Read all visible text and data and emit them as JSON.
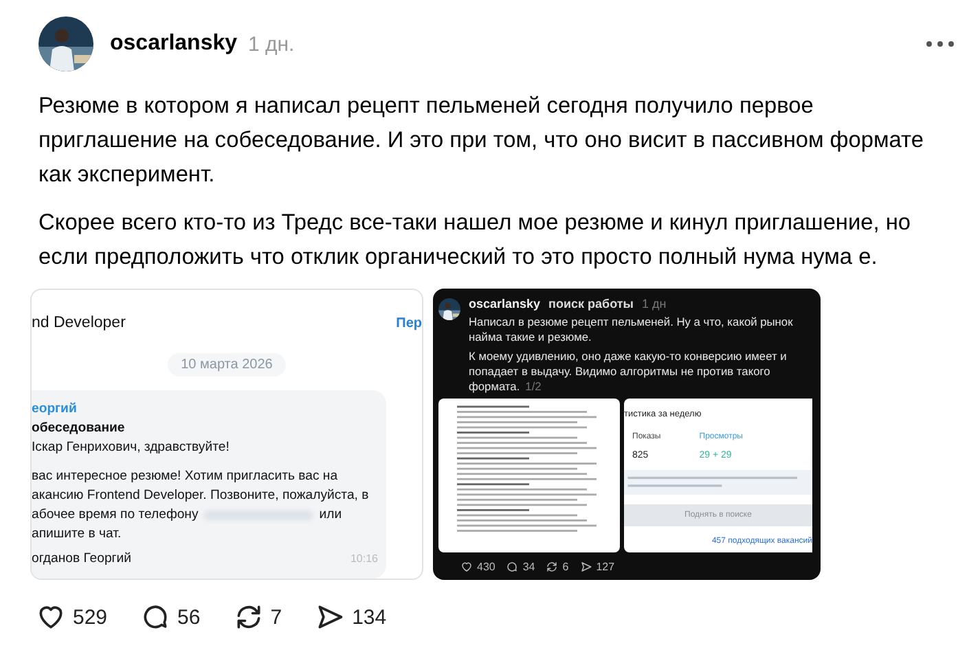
{
  "post": {
    "author": "oscarlansky",
    "time": "1 дн.",
    "paragraphs": [
      "Резюме в котором я написал рецепт пельменей сегодня получило первое приглашение на собеседование. И это при том, что оно висит в пассивном формате как эксперимент.",
      "Скорее всего кто-то из Тредс все-таки нашел мое резюме и кинул приглашение, но если предположить что отклик органический то это просто полный нума нума е."
    ]
  },
  "chat_screenshot": {
    "header_title": "nd Developer",
    "header_link": "Пер",
    "date": "10 марта 2026",
    "sender": "еоргий",
    "subject": "обеседование",
    "greeting": "Іскар Генрихович, здравствуйте!",
    "body_lines": [
      "вас интересное резюме! Хотим пригласить вас на",
      "акансию Frontend Developer. Позвоните, пожалуйста, в",
      "абочее время по телефону",
      "или",
      "апишите в чат."
    ],
    "signature": "огданов Георгий",
    "time": "10:16"
  },
  "thread_screenshot": {
    "author": "oscarlansky",
    "topic": "поиск работы",
    "time": "1 дн",
    "paragraphs": [
      "Написал в резюме рецепт пельменей. Ну а что, какой рынок найма такие и резюме.",
      "К моему удивлению, оно даже какую-то конверсию имеет и попадает в выдачу. Видимо алгоритмы не против такого формата."
    ],
    "page_counter": "1/2",
    "stats": {
      "title": "тистика за неделю",
      "columns": [
        {
          "label": "Показы",
          "value": "825"
        },
        {
          "label": "Просмотры",
          "value": "29 + 29"
        }
      ],
      "button": "Поднять в поиске",
      "link": "457 подходящих вакансий"
    },
    "actions": [
      {
        "kind": "like",
        "count": "430"
      },
      {
        "kind": "reply",
        "count": "34"
      },
      {
        "kind": "repost",
        "count": "6"
      },
      {
        "kind": "share",
        "count": "127"
      }
    ]
  },
  "actions": [
    {
      "kind": "like",
      "count": "529"
    },
    {
      "kind": "reply",
      "count": "56"
    },
    {
      "kind": "repost",
      "count": "7"
    },
    {
      "kind": "share",
      "count": "134"
    }
  ]
}
